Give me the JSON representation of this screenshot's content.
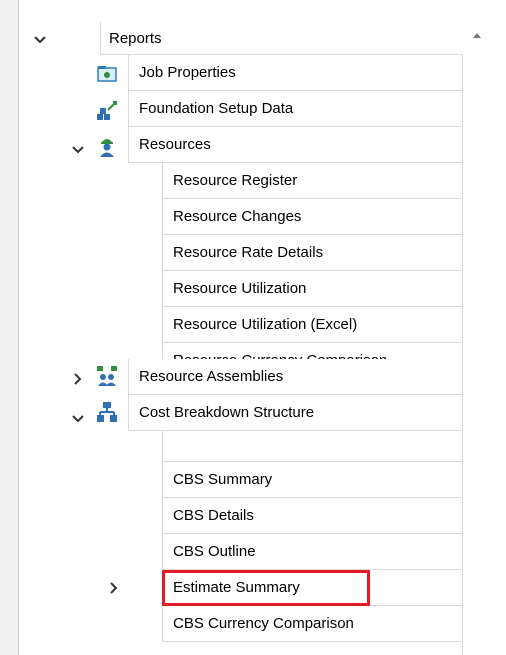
{
  "tree": {
    "root": {
      "label": "Reports"
    },
    "items": [
      {
        "label": "Job Properties",
        "icon": "job-properties-icon"
      },
      {
        "label": "Foundation Setup Data",
        "icon": "foundation-setup-icon"
      },
      {
        "label": "Resources",
        "icon": "resources-icon",
        "children": [
          {
            "label": "Resource Register"
          },
          {
            "label": "Resource Changes"
          },
          {
            "label": "Resource Rate Details"
          },
          {
            "label": "Resource Utilization"
          },
          {
            "label": "Resource Utilization (Excel)"
          },
          {
            "label": "Resource Currency Comparison"
          }
        ]
      },
      {
        "label": "Resource Assemblies",
        "icon": "resource-assemblies-icon"
      },
      {
        "label": "Cost Breakdown Structure",
        "icon": "cbs-icon",
        "children": [
          {
            "label": "CBS Summary"
          },
          {
            "label": "CBS Details"
          },
          {
            "label": "CBS Outline"
          },
          {
            "label": "Estimate Summary",
            "highlighted": true
          },
          {
            "label": "CBS Currency Comparison"
          }
        ]
      }
    ]
  },
  "colors": {
    "highlight": "#e21c24",
    "accent_blue": "#1f6fb2",
    "accent_green": "#2f8f3c"
  }
}
